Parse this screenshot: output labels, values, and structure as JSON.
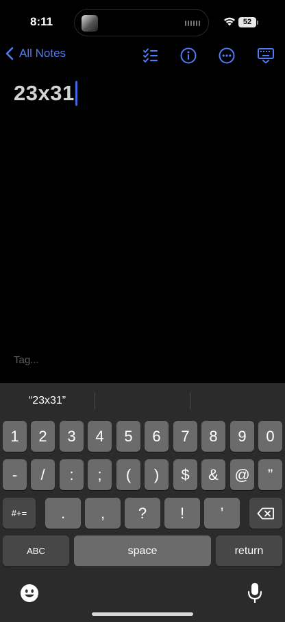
{
  "status": {
    "time": "8:11",
    "battery": "52"
  },
  "nav": {
    "back_label": "All Notes",
    "icons": [
      "checklist-icon",
      "info-icon",
      "more-icon",
      "keyboard-dismiss-icon"
    ],
    "accent": "#4f7cf5"
  },
  "note": {
    "title": "23x31",
    "tag_placeholder": "Tag..."
  },
  "keyboard": {
    "suggestions": [
      "“23x31”",
      "",
      ""
    ],
    "row1": [
      "1",
      "2",
      "3",
      "4",
      "5",
      "6",
      "7",
      "8",
      "9",
      "0"
    ],
    "row2": [
      "-",
      "/",
      ":",
      ";",
      "(",
      ")",
      "$",
      "&",
      "@",
      "”"
    ],
    "row3": [
      ".",
      ",",
      "?",
      "!",
      "’"
    ],
    "symbols_label": "#+=",
    "abc_label": "ABC",
    "space_label": "space",
    "return_label": "return"
  }
}
